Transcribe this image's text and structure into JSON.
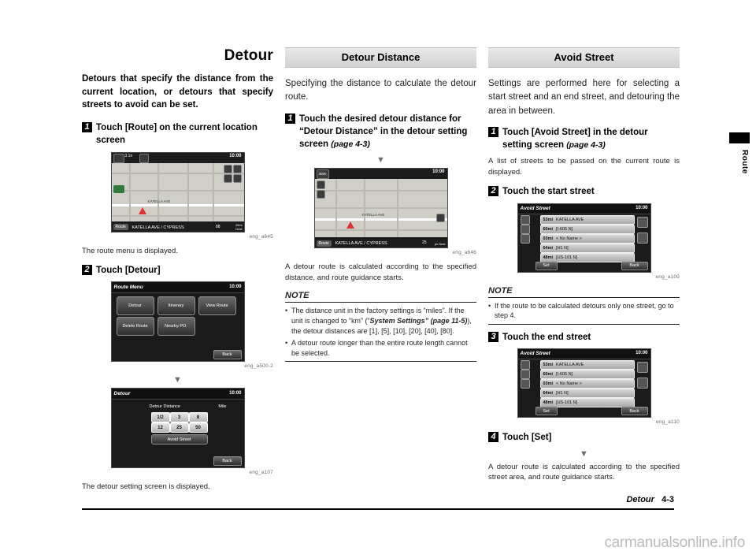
{
  "page": {
    "footer_section": "Detour",
    "footer_page": "4-3",
    "side_tab_label": "Route",
    "watermark": "carmanualsonline.info"
  },
  "col1": {
    "title": "Detour",
    "lead": "Detours that specify the distance from the current location, or detours that specify streets to avoid can be set.",
    "step1_num": "1",
    "step1_text": "Touch [Route] on the current location screen",
    "caption1": "eng_a645",
    "after1": "The route menu is displayed.",
    "step2_num": "2",
    "step2_text": "Touch [Detour]",
    "caption2": "eng_a500-2",
    "arrow": "▼",
    "caption3": "eng_a107",
    "after2": "The detour setting screen is displayed.",
    "map_shot": {
      "clock": "10:00",
      "right_tag": "4 F T",
      "left_tag": "3.1n",
      "route_button": "Route",
      "street": "KATELLA AVE / CYPRESS",
      "dist": "88",
      "eta_top": "25mi",
      "eta_bottom": "Dest"
    },
    "menu_shot": {
      "title": "Route Menu",
      "clock": "10:00",
      "buttons": [
        "Detour",
        "Itinerary",
        "View Route",
        "Delete Route",
        "Nearby PO."
      ],
      "back": "Back"
    },
    "detour_shot": {
      "title": "Detour",
      "clock": "10:00",
      "label": "Detour Distance",
      "unit": "Mile",
      "values": [
        "1/2",
        "3",
        "8",
        "12",
        "25",
        "50"
      ],
      "avoid_button": "Avoid Street",
      "back": "Back"
    }
  },
  "col2": {
    "header": "Detour Distance",
    "intro": "Specifying the distance to calculate the detour route.",
    "step1_num": "1",
    "step1_text": "Touch the desired detour distance for “Detour Distance” in the detour setting screen",
    "step1_ref": "(page 4-3)",
    "arrow": "▼",
    "caption": "eng_a646",
    "after": "A detour route is calculated according to the specified distance, and route guidance starts.",
    "note_title": "NOTE",
    "notes": [
      {
        "pre": "The distance unit in the factory settings is “miles”. If the unit is changed to “km” (“",
        "ital": "System Settings” (page 11-5)",
        "post": "), the detour distances are [1], [5], [10], [20], [40], [80]."
      },
      {
        "pre": "A detour route longer than the entire route length cannot be selected.",
        "ital": "",
        "post": ""
      }
    ],
    "map_shot": {
      "clock": "10:00",
      "right_tag": "4 F T",
      "left_tag": "300n",
      "route_button": "Route",
      "street": "KATELLA AVE / CYPRESS",
      "dist": "25",
      "eta_bottom": "pv Dest"
    }
  },
  "col3": {
    "header": "Avoid Street",
    "intro": "Settings are performed here for selecting a start street and an end street, and detouring the area in between.",
    "step1_num": "1",
    "step1_text": "Touch [Avoid Street] in the detour setting screen",
    "step1_ref": "(page 4-3)",
    "step1_after": "A list of streets to be passed on the current route is displayed.",
    "step2_num": "2",
    "step2_text": "Touch the start street",
    "caption1": "eng_a109",
    "note_title": "NOTE",
    "note_text": "If the route to be calculated detours only one street, go to step 4.",
    "step3_num": "3",
    "step3_text": "Touch the end street",
    "caption2": "eng_a110",
    "step4_num": "4",
    "step4_text": "Touch [Set]",
    "arrow": "▼",
    "after": "A detour route is calculated according to the specified street area, and route guidance starts.",
    "list_shot": {
      "title": "Avoid Street",
      "clock": "10:00",
      "rows": [
        {
          "dist": "53mi",
          "name": "KATELLA AVE"
        },
        {
          "dist": "60mi",
          "name": "[I-605 N]"
        },
        {
          "dist": "03mi",
          "name": "< No Name >"
        },
        {
          "dist": "64mi",
          "name": "[H1 N]"
        },
        {
          "dist": "48mi",
          "name": "[US-101 N]"
        }
      ],
      "set": "Set",
      "back": "Back"
    },
    "list_shot2": {
      "title": "Avoid Street",
      "clock": "10:00",
      "rows": [
        {
          "dist": "53mi",
          "name": "KATELLA AVE"
        },
        {
          "dist": "60mi",
          "name": "[I-605 N]"
        },
        {
          "dist": "03mi",
          "name": "< No Name >"
        },
        {
          "dist": "64mi",
          "name": "[H1 N]"
        },
        {
          "dist": "48mi",
          "name": "[US-101 N]"
        }
      ],
      "set": "Set",
      "back": "Back"
    }
  }
}
